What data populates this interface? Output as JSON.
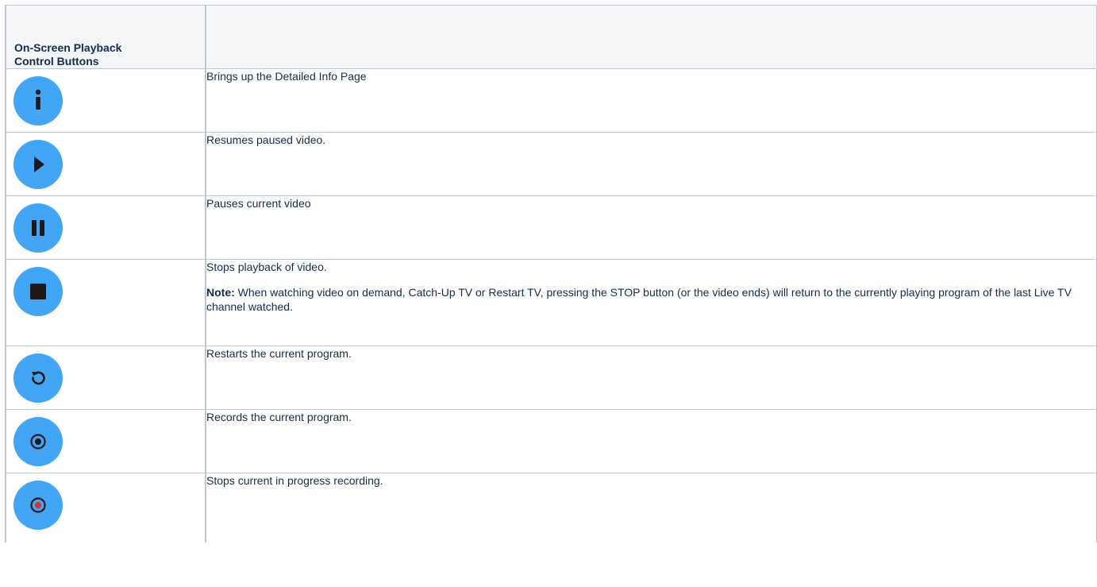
{
  "table": {
    "header": {
      "col1_line1": "On-Screen Playback",
      "col1_line2": "Control Buttons",
      "col2": ""
    },
    "rows": [
      {
        "icon": "info-icon",
        "description": "Brings up the Detailed Info Page"
      },
      {
        "icon": "play-icon",
        "description": "Resumes paused video."
      },
      {
        "icon": "pause-icon",
        "description": "Pauses current video"
      },
      {
        "icon": "stop-icon",
        "description": "Stops playback of video.",
        "note_label": "Note:",
        "note_text": " When watching video on demand, Catch-Up TV or Restart TV, pressing the STOP button (or the video ends) will return to the currently playing program of the last Live TV channel watched."
      },
      {
        "icon": "restart-icon",
        "description": "Restarts the current program."
      },
      {
        "icon": "record-icon",
        "description": "Records the current program."
      },
      {
        "icon": "stop-recording-icon",
        "description": "Stops current in progress recording."
      }
    ]
  },
  "colors": {
    "button_blue": "#42a5f5",
    "icon_dark": "#1a1a1a",
    "record_red": "#d32f2f",
    "border": "#c1c7d0",
    "header_bg": "#f4f5f7"
  }
}
